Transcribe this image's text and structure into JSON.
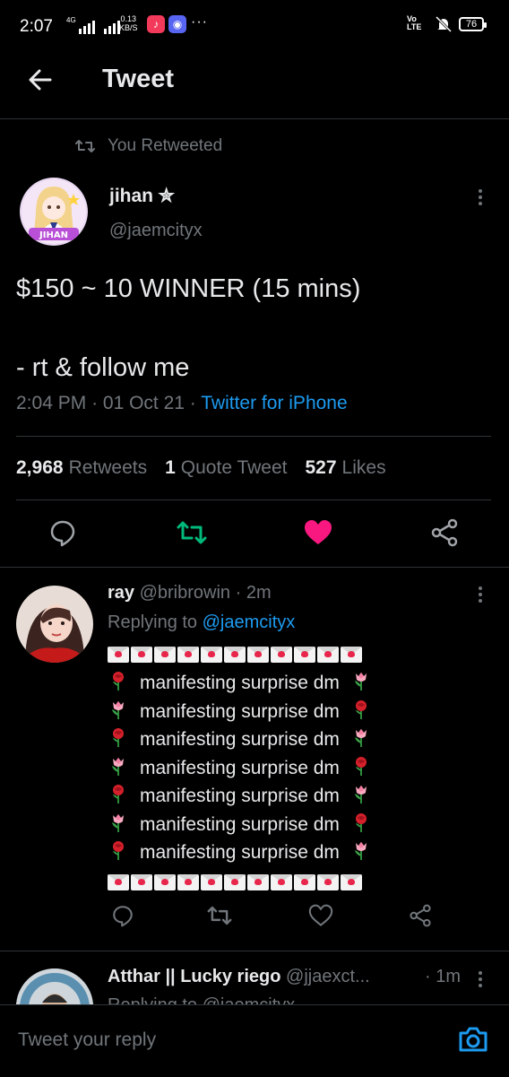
{
  "status_bar": {
    "time": "2:07",
    "network": "4G",
    "speed_value": "0.13",
    "speed_unit": "KB/S",
    "more": "···",
    "volte_top": "Vo",
    "volte_bottom": "LTE",
    "battery": "76"
  },
  "header": {
    "title": "Tweet",
    "back_icon": "arrow-left-icon"
  },
  "tweet": {
    "retweet_note": "You Retweeted",
    "display_name": "jihan ✮",
    "handle": "@jaemcityx",
    "avatar_label": "JIHAN",
    "text": "$150 ~ 10 WINNER (15 mins)\n\n- rt & follow me",
    "time": "2:04 PM",
    "date": "01 Oct 21",
    "source": "Twitter for iPhone",
    "stats": {
      "retweets_count": "2,968",
      "retweets_label": "Retweets",
      "quotes_count": "1",
      "quotes_label": "Quote Tweet",
      "likes_count": "527",
      "likes_label": "Likes"
    },
    "colors": {
      "retweet": "#00ba7c",
      "like": "#f91880",
      "link": "#1d9bf0"
    }
  },
  "reply": {
    "display_name": "ray",
    "handle": "@bribrowin",
    "time": "2m",
    "replying_prefix": "Replying to",
    "replying_to": "@jaemcityx",
    "lines": [
      {
        "text": "manifesting surprise dm",
        "left": "rose",
        "right": "tulip"
      },
      {
        "text": "manifesting surprise dm",
        "left": "tulip",
        "right": "rose"
      },
      {
        "text": "manifesting surprise dm",
        "left": "rose",
        "right": "tulip"
      },
      {
        "text": "manifesting surprise dm",
        "left": "tulip",
        "right": "rose"
      },
      {
        "text": "manifesting surprise dm",
        "left": "rose",
        "right": "tulip"
      },
      {
        "text": "manifesting surprise dm",
        "left": "tulip",
        "right": "rose"
      },
      {
        "text": "manifesting surprise dm",
        "left": "rose",
        "right": "tulip"
      }
    ],
    "envelope_count": 11
  },
  "reply2": {
    "display_name": "Atthar || Lucky riego",
    "handle": "@jjaexct...",
    "time": "· 1m",
    "replying_partial": "Replying to @jaemcityx"
  },
  "composer": {
    "placeholder": "Tweet your reply"
  }
}
